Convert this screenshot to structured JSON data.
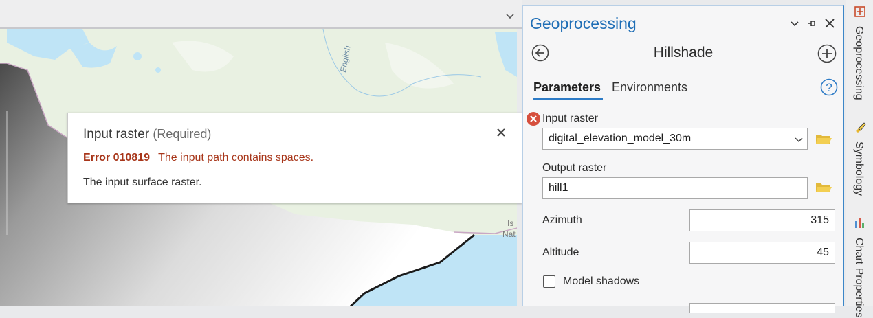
{
  "map": {
    "labels": {
      "river": "English",
      "is": "Is",
      "nat": "Nat"
    }
  },
  "popup": {
    "title": "Input raster",
    "required": "(Required)",
    "error_code": "Error 010819",
    "error_message": "The input path contains spaces.",
    "description": "The input surface raster."
  },
  "geoprocessing": {
    "title": "Geoprocessing",
    "tool_name": "Hillshade",
    "tabs": [
      {
        "label": "Parameters",
        "active": true
      },
      {
        "label": "Environments",
        "active": false
      }
    ],
    "params": {
      "input_raster": {
        "label": "Input raster",
        "value": "digital_elevation_model_30m",
        "status": "error"
      },
      "output_raster": {
        "label": "Output raster",
        "value": "hill1"
      },
      "azimuth": {
        "label": "Azimuth",
        "value": "315"
      },
      "altitude": {
        "label": "Altitude",
        "value": "45"
      },
      "model_shadows": {
        "label": "Model shadows",
        "checked": false
      }
    }
  },
  "side_rail": {
    "tabs": [
      {
        "label": "Geoprocessing",
        "icon": "geoprocessing-icon"
      },
      {
        "label": "Symbology",
        "icon": "symbology-brush-icon"
      },
      {
        "label": "Chart Properties",
        "icon": "chart-icon"
      }
    ]
  },
  "colors": {
    "accent": "#1f6eb6",
    "error": "#a8361a",
    "error_icon": "#d64f3d",
    "water": "#bfe4f6",
    "land": "#e9f1e2"
  }
}
